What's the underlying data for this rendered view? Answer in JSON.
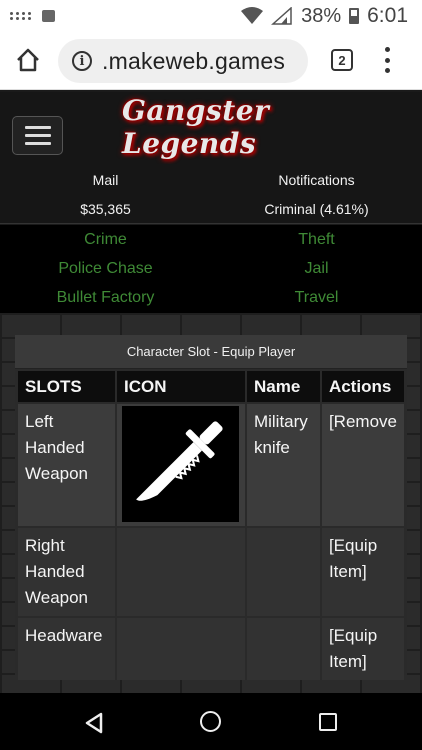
{
  "statusbar": {
    "battery": "38%",
    "time": "6:01"
  },
  "browser": {
    "url": ".makeweb.games",
    "tab_count": "2"
  },
  "site": {
    "logo_text": "Gangster Legends"
  },
  "info": {
    "mail": "Mail",
    "notifications": "Notifications",
    "money": "$35,365",
    "rank": "Criminal (4.61%)"
  },
  "nav": [
    {
      "label": "Crime"
    },
    {
      "label": "Theft"
    },
    {
      "label": "Police Chase"
    },
    {
      "label": "Jail"
    },
    {
      "label": "Bullet Factory"
    },
    {
      "label": "Travel"
    }
  ],
  "panel": {
    "title": "Character Slot - Equip Player",
    "headers": [
      "SLOTS",
      "ICON",
      "Name",
      "Actions"
    ],
    "rows": [
      {
        "slot": "Left Handed Weapon",
        "icon": "knife-icon",
        "name": "Military knife",
        "action": "[Remove"
      },
      {
        "slot": "Right Handed Weapon",
        "icon": "",
        "name": "",
        "action": "[Equip Item]"
      },
      {
        "slot": "Headware",
        "icon": "",
        "name": "",
        "action": "[Equip Item]"
      }
    ]
  }
}
